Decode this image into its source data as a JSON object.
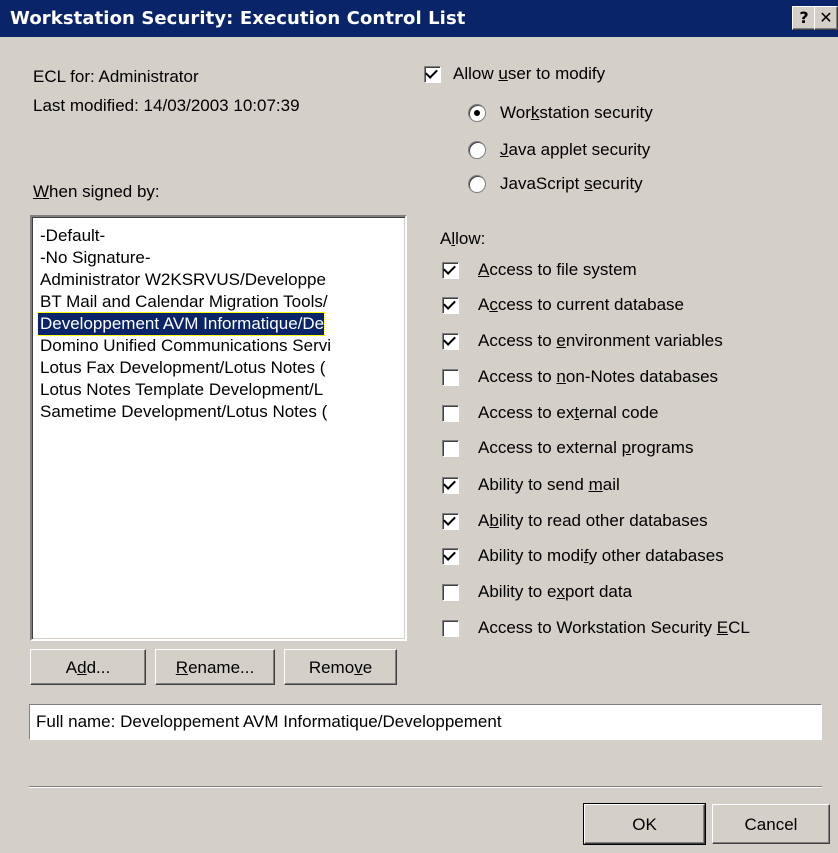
{
  "window": {
    "title": "Workstation Security:  Execution Control List",
    "help_btn": "?",
    "close_btn": "✕"
  },
  "header": {
    "ecl_for": "ECL for:  Administrator",
    "last_modified": "Last modified:  14/03/2003 10:07:39"
  },
  "allow_modify": {
    "label_pre": "Allow ",
    "label_u": "u",
    "label_post": "ser to modify",
    "checked": true
  },
  "security_options": [
    {
      "pre": "Wor",
      "u": "k",
      "post": "station security",
      "selected": true
    },
    {
      "pre": "",
      "u": "J",
      "post": "ava applet security",
      "selected": false
    },
    {
      "pre": "JavaScript ",
      "u": "s",
      "post": "ecurity",
      "selected": false
    }
  ],
  "signers": {
    "label_u": "W",
    "label_post": "hen signed by:",
    "items": [
      "-Default-",
      "-No Signature-",
      "Administrator W2KSRVUS/Developpe",
      "BT Mail and Calendar Migration Tools/",
      "Developpement AVM Informatique/De",
      "Domino Unified Communications Servi",
      "Lotus Fax Development/Lotus Notes (",
      "Lotus Notes Template Development/L",
      "Sametime Development/Lotus Notes ("
    ],
    "selected_index": 4
  },
  "allow": {
    "label_pre": "A",
    "label_u": "l",
    "label_post": "low:",
    "options": [
      {
        "pre": "",
        "u": "A",
        "post": "ccess to file system",
        "checked": true
      },
      {
        "pre": "A",
        "u": "c",
        "post": "cess to current database",
        "checked": true
      },
      {
        "pre": "Access to ",
        "u": "e",
        "post": "nvironment variables",
        "checked": true
      },
      {
        "pre": "Access to ",
        "u": "n",
        "post": "on-Notes databases",
        "checked": false
      },
      {
        "pre": "Access to ex",
        "u": "t",
        "post": "ernal code",
        "checked": false
      },
      {
        "pre": "Access to external ",
        "u": "p",
        "post": "rograms",
        "checked": false
      },
      {
        "pre": "Ability to send ",
        "u": "m",
        "post": "ail",
        "checked": true
      },
      {
        "pre": "A",
        "u": "b",
        "post": "ility to read other databases",
        "checked": true
      },
      {
        "pre": "Ability to modi",
        "u": "f",
        "post": "y other databases",
        "checked": true
      },
      {
        "pre": "Ability to e",
        "u": "x",
        "post": "port data",
        "checked": false
      },
      {
        "pre": "Access to Workstation Security ",
        "u": "E",
        "post": "CL",
        "checked": false
      }
    ]
  },
  "buttons": {
    "add": {
      "pre": "A",
      "u": "d",
      "post": "d..."
    },
    "rename": {
      "pre": "",
      "u": "R",
      "post": "ename..."
    },
    "remove": {
      "pre": "Remo",
      "u": "v",
      "post": "e"
    },
    "ok": "OK",
    "cancel": "Cancel"
  },
  "full_name": "Full name: Developpement AVM Informatique/Developpement"
}
